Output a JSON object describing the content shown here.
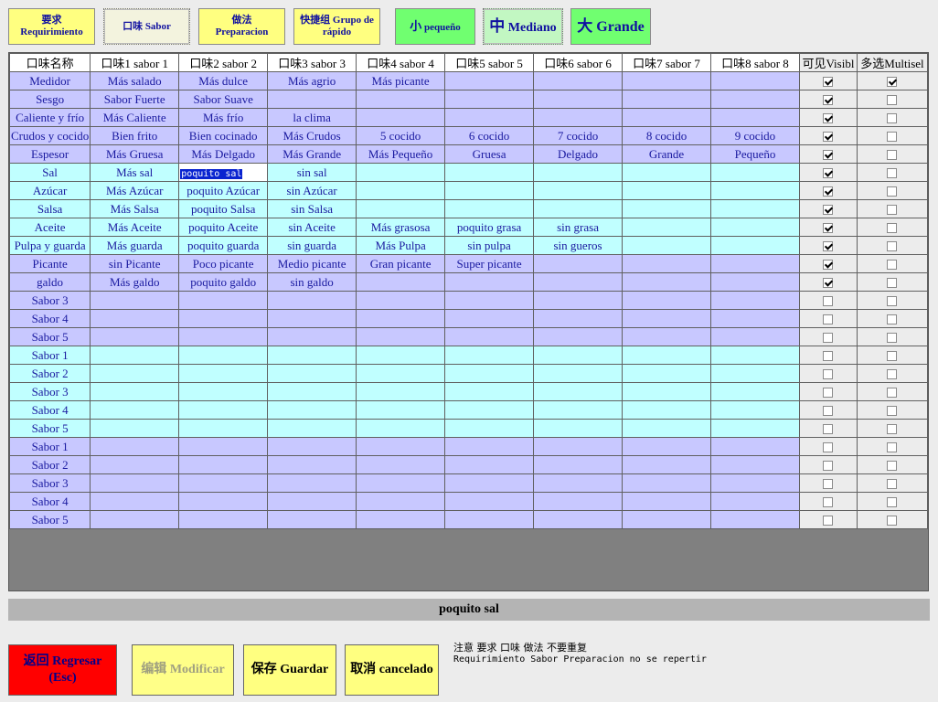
{
  "top_tabs": [
    {
      "zh": "要求",
      "es": "Requirimiento"
    },
    {
      "zh": "口味",
      "es": "Sabor"
    },
    {
      "zh": "做法",
      "es": "Preparacion"
    },
    {
      "zh": "快捷组",
      "es": "Grupo de rápido"
    }
  ],
  "sizes": [
    {
      "zh": "小",
      "es": "pequeño"
    },
    {
      "zh": "中",
      "es": "Mediano"
    },
    {
      "zh": "大",
      "es": "Grande"
    }
  ],
  "table": {
    "headers": [
      "口味名称",
      "口味1 sabor 1",
      "口味2 sabor 2",
      "口味3 sabor 3",
      "口味4 sabor 4",
      "口味5 sabor 5",
      "口味6 sabor 6",
      "口味7 sabor 7",
      "口味8 sabor 8",
      "可见Visibl",
      "多选Multisel"
    ],
    "rows": [
      {
        "name": "Medidor",
        "cells": [
          "Más salado",
          "Más dulce",
          "Más agrio",
          "Más picante",
          "",
          "",
          "",
          ""
        ],
        "visible": true,
        "multi": true
      },
      {
        "name": "Sesgo",
        "cells": [
          "Sabor Fuerte",
          "Sabor Suave",
          "",
          "",
          "",
          "",
          "",
          ""
        ],
        "visible": true,
        "multi": false
      },
      {
        "name": "Caliente y frío",
        "cells": [
          "Más Caliente",
          "Más frío",
          "la clima",
          "",
          "",
          "",
          "",
          ""
        ],
        "visible": true,
        "multi": false
      },
      {
        "name": "Crudos y cocido",
        "cells": [
          "Bien frito",
          "Bien cocinado",
          "Más Crudos",
          "5 cocido",
          "6 cocido",
          "7 cocido",
          "8 cocido",
          "9 cocido"
        ],
        "visible": true,
        "multi": false
      },
      {
        "name": "Espesor",
        "cells": [
          "Más Gruesa",
          "Más Delgado",
          "Más Grande",
          "Más Pequeño",
          "Gruesa",
          "Delgado",
          "Grande",
          "Pequeño"
        ],
        "visible": true,
        "multi": false
      },
      {
        "name": "Sal",
        "cells": [
          "Más sal",
          "poquito sal",
          "sin sal",
          "",
          "",
          "",
          "",
          ""
        ],
        "visible": true,
        "multi": false
      },
      {
        "name": "Azúcar",
        "cells": [
          "Más Azúcar",
          "poquito Azúcar",
          "sin Azúcar",
          "",
          "",
          "",
          "",
          ""
        ],
        "visible": true,
        "multi": false
      },
      {
        "name": "Salsa",
        "cells": [
          "Más Salsa",
          "poquito Salsa",
          "sin Salsa",
          "",
          "",
          "",
          "",
          ""
        ],
        "visible": true,
        "multi": false
      },
      {
        "name": "Aceite",
        "cells": [
          "Más Aceite",
          "poquito Aceite",
          "sin Aceite",
          "Más grasosa",
          "poquito grasa",
          "sin grasa",
          "",
          ""
        ],
        "visible": true,
        "multi": false
      },
      {
        "name": "Pulpa y guarda",
        "cells": [
          "Más guarda",
          "poquito guarda",
          "sin guarda",
          "Más Pulpa",
          "sin pulpa",
          "sin gueros",
          "",
          ""
        ],
        "visible": true,
        "multi": false
      },
      {
        "name": "Picante",
        "cells": [
          "sin Picante",
          "Poco picante",
          "Medio picante",
          "Gran picante",
          "Super picante",
          "",
          "",
          ""
        ],
        "visible": true,
        "multi": false
      },
      {
        "name": "galdo",
        "cells": [
          "Más galdo",
          "poquito galdo",
          "sin galdo",
          "",
          "",
          "",
          "",
          ""
        ],
        "visible": true,
        "multi": false
      },
      {
        "name": "Sabor 3",
        "cells": [
          "",
          "",
          "",
          "",
          "",
          "",
          "",
          ""
        ],
        "visible": false,
        "multi": false
      },
      {
        "name": "Sabor 4",
        "cells": [
          "",
          "",
          "",
          "",
          "",
          "",
          "",
          ""
        ],
        "visible": false,
        "multi": false
      },
      {
        "name": "Sabor 5",
        "cells": [
          "",
          "",
          "",
          "",
          "",
          "",
          "",
          ""
        ],
        "visible": false,
        "multi": false
      },
      {
        "name": "Sabor 1",
        "cells": [
          "",
          "",
          "",
          "",
          "",
          "",
          "",
          ""
        ],
        "visible": false,
        "multi": false
      },
      {
        "name": "Sabor 2",
        "cells": [
          "",
          "",
          "",
          "",
          "",
          "",
          "",
          ""
        ],
        "visible": false,
        "multi": false
      },
      {
        "name": "Sabor 3",
        "cells": [
          "",
          "",
          "",
          "",
          "",
          "",
          "",
          ""
        ],
        "visible": false,
        "multi": false
      },
      {
        "name": "Sabor 4",
        "cells": [
          "",
          "",
          "",
          "",
          "",
          "",
          "",
          ""
        ],
        "visible": false,
        "multi": false
      },
      {
        "name": "Sabor 5",
        "cells": [
          "",
          "",
          "",
          "",
          "",
          "",
          "",
          ""
        ],
        "visible": false,
        "multi": false
      },
      {
        "name": "Sabor 1",
        "cells": [
          "",
          "",
          "",
          "",
          "",
          "",
          "",
          ""
        ],
        "visible": false,
        "multi": false
      },
      {
        "name": "Sabor 2",
        "cells": [
          "",
          "",
          "",
          "",
          "",
          "",
          "",
          ""
        ],
        "visible": false,
        "multi": false
      },
      {
        "name": "Sabor 3",
        "cells": [
          "",
          "",
          "",
          "",
          "",
          "",
          "",
          ""
        ],
        "visible": false,
        "multi": false
      },
      {
        "name": "Sabor 4",
        "cells": [
          "",
          "",
          "",
          "",
          "",
          "",
          "",
          ""
        ],
        "visible": false,
        "multi": false
      },
      {
        "name": "Sabor 5",
        "cells": [
          "",
          "",
          "",
          "",
          "",
          "",
          "",
          ""
        ],
        "visible": false,
        "multi": false
      }
    ]
  },
  "status_text": "poquito sal",
  "buttons": {
    "back": {
      "zh": "返回",
      "es": "Regresar",
      "key": "(Esc)"
    },
    "edit": {
      "zh": "编辑",
      "es": "Modificar"
    },
    "save": {
      "zh": "保存",
      "es": "Guardar"
    },
    "cancel": {
      "zh": "取消",
      "es": "cancelado"
    }
  },
  "note": {
    "line1": "注意 要求 口味 做法 不要重复",
    "line2": "Requirimiento Sabor Preparacion no se repertir"
  },
  "colors": {
    "row_purple": "#c8c8ff",
    "row_cyan": "#c0ffff",
    "back_button": "#ff0000",
    "yellow_button": "#ffff80",
    "size_green": "#70ff70"
  }
}
